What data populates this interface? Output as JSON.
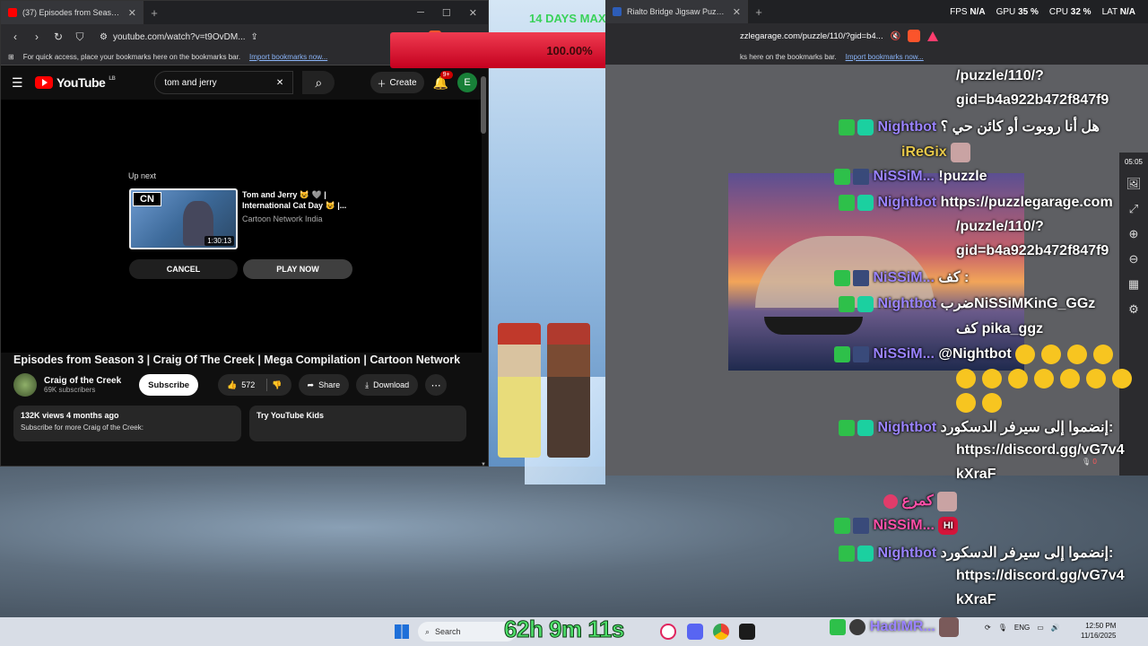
{
  "overlay": {
    "days_max": "14 DAYS MAX",
    "progress_text": "100.00%",
    "progress_fraction": 1.0,
    "timer": "62h 9m 11s"
  },
  "left_browser": {
    "tab_title": "(37) Episodes from Season 3 | Cr",
    "url": "youtube.com/watch?v=t9OvDM...",
    "bookmarks_prompt": "For quick access, place your bookmarks here on the bookmarks bar.",
    "bookmarks_link": "Import bookmarks now..."
  },
  "youtube": {
    "logo_text": "YouTube",
    "logo_region": "LB",
    "search_value": "tom and jerry",
    "create_label": "Create",
    "notification_count": "9+",
    "account_initial": "E",
    "up_next_label": "Up next",
    "up_next_title": "Tom and Jerry 😺 🩶 | International Cat Day 😺 |...",
    "up_next_channel": "Cartoon Network India",
    "up_next_duration": "1:30:13",
    "cn_logo": "CN",
    "cancel_label": "CANCEL",
    "play_now_label": "PLAY NOW",
    "video_title": "Episodes from Season 3 | Craig Of The Creek | Mega Compilation | Cartoon Network",
    "channel_name": "Craig of the Creek",
    "channel_subs": "69K subscribers",
    "subscribe_label": "Subscribe",
    "like_count": "572",
    "share_label": "Share",
    "download_label": "Download",
    "views_line": "132K views  4 months ago",
    "description_snippet": "Subscribe for more Craig of the Creek:",
    "kids_label": "Try YouTube Kids"
  },
  "right_browser": {
    "tab_title": "Rialto Bridge Jigsaw Puzzle (Cou",
    "url": "zzlegarage.com/puzzle/110/?gid=b4...",
    "bookmarks_prompt": "ks here on the bookmarks bar.",
    "bookmarks_link": "Import bookmarks now..."
  },
  "stats": [
    {
      "label": "FPS",
      "value": "N/A"
    },
    {
      "label": "GPU",
      "value": "35 %"
    },
    {
      "label": "CPU",
      "value": "32 %"
    },
    {
      "label": "LAT",
      "value": "N/A"
    }
  ],
  "side_panel": {
    "time": "05:05",
    "mic_value": "0"
  },
  "chat": {
    "line_url_tail": "/puzzle/110/?",
    "line_gid": "gid=b4a922b472f847f9",
    "nightbot": "Nightbot",
    "msg_robot": "هل أنا روبوت أو كائن حي ؟",
    "iregix": "iReGix",
    "nissim": "NiSSiM...",
    "msg_puzzle": "!puzzle",
    "msg_puzzle_url": "https://puzzlegarage.com",
    "msg_puzzle_url2": "/puzzle/110/?",
    "msg_puzzle_gid": "gid=b4a922b472f847f9",
    "msg_kaf": "كف :",
    "msg_hit": "ضربNiSSiMKinG_GGz",
    "msg_pika": "كف pika_ggz",
    "msg_mention": "@Nightbot",
    "msg_discord": "إنضموا إلى سيرفر الدسكورد:",
    "discord_url_1": "https://discord.gg/vG7v4",
    "discord_url_2": "kXraF",
    "pink_name": "كمرع",
    "hadi": "HadiMR..."
  },
  "taskbar": {
    "search_label": "Search",
    "lang": "ENG",
    "time": "12:50 PM",
    "date": "11/16/2025"
  }
}
